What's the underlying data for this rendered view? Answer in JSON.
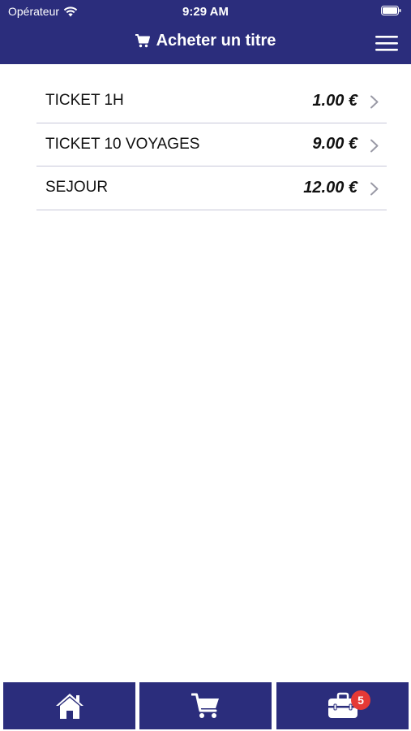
{
  "status_bar": {
    "carrier": "Opérateur",
    "time": "9:29 AM"
  },
  "header": {
    "title": "Acheter un titre",
    "title_icon": "cart-icon",
    "menu_icon": "hamburger-menu-icon"
  },
  "tickets": [
    {
      "name": "TICKET 1H",
      "price": "1.00 €"
    },
    {
      "name": "TICKET 10 VOYAGES",
      "price": "9.00 €"
    },
    {
      "name": "SEJOUR",
      "price": "12.00 €"
    }
  ],
  "tabbar": {
    "tabs": [
      {
        "icon": "home-icon"
      },
      {
        "icon": "cart-icon"
      },
      {
        "icon": "toolbox-icon",
        "badge": "5"
      }
    ]
  },
  "colors": {
    "primary": "#2b2d7c",
    "badge": "#e53935",
    "divider": "#c7c7d9"
  }
}
